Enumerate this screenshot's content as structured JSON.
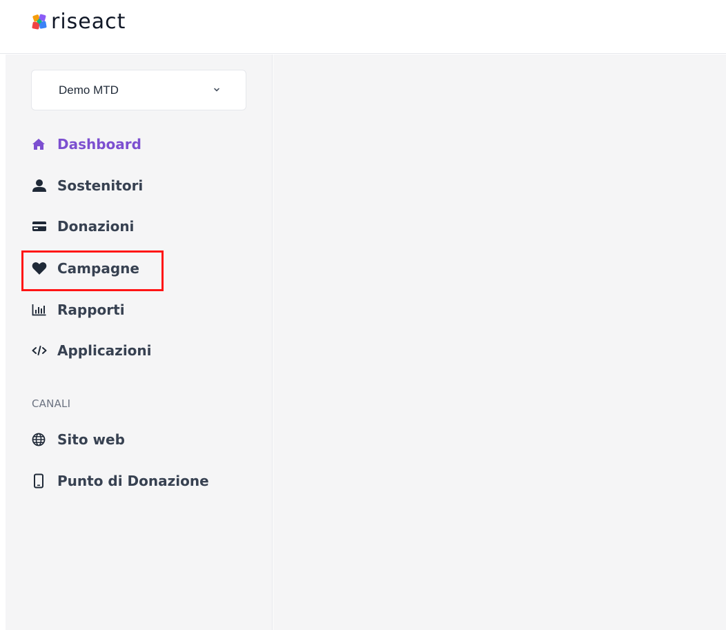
{
  "brand": {
    "name": "riseact",
    "logo_colors": [
      "#f59e0b",
      "#ef4444",
      "#8b5cf6",
      "#3b82f6",
      "#10b981"
    ]
  },
  "org_selector": {
    "value": "Demo MTD",
    "icon": "chevron-down-icon"
  },
  "nav": {
    "items": [
      {
        "label": "Dashboard",
        "icon": "home-icon",
        "active": true
      },
      {
        "label": "Sostenitori",
        "icon": "user-icon",
        "active": false
      },
      {
        "label": "Donazioni",
        "icon": "credit-card-icon",
        "active": false
      },
      {
        "label": "Campagne",
        "icon": "heart-icon",
        "active": false,
        "highlighted": true
      },
      {
        "label": "Rapporti",
        "icon": "bar-chart-icon",
        "active": false
      },
      {
        "label": "Applicazioni",
        "icon": "code-icon",
        "active": false
      }
    ],
    "channels_heading": "CANALI",
    "channels": [
      {
        "label": "Sito web",
        "icon": "globe-icon"
      },
      {
        "label": "Punto di Donazione",
        "icon": "mobile-icon"
      }
    ]
  },
  "colors": {
    "accent": "#7c4fd0",
    "text": "#374151",
    "highlight": "#ff1414",
    "background": "#f5f5f6"
  }
}
